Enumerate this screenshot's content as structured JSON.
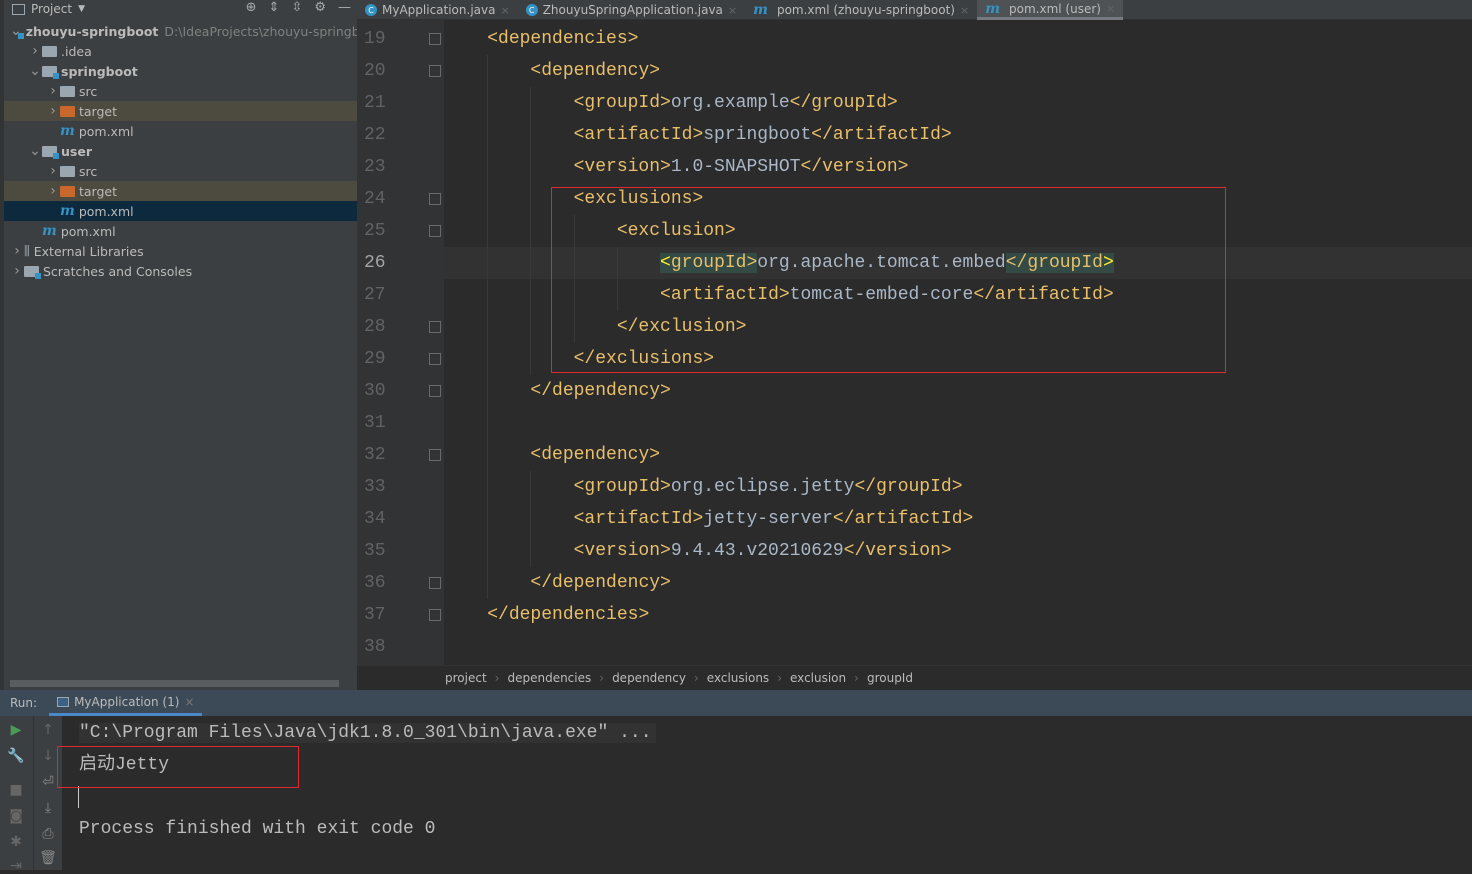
{
  "project_panel": {
    "title": "Project",
    "tree": [
      {
        "label": "zhouyu-springboot",
        "path": "D:\\IdeaProjects\\zhouyu-springb",
        "level": 0,
        "expanded": true,
        "type": "module",
        "bold": true
      },
      {
        "label": ".idea",
        "level": 1,
        "expanded": false,
        "type": "folder"
      },
      {
        "label": "springboot",
        "level": 1,
        "expanded": true,
        "type": "module",
        "bold": true
      },
      {
        "label": "src",
        "level": 2,
        "expanded": false,
        "type": "folder"
      },
      {
        "label": "target",
        "level": 2,
        "expanded": false,
        "type": "target"
      },
      {
        "label": "pom.xml",
        "level": 2,
        "type": "maven"
      },
      {
        "label": "user",
        "level": 1,
        "expanded": true,
        "type": "module",
        "bold": true
      },
      {
        "label": "src",
        "level": 2,
        "expanded": false,
        "type": "folder"
      },
      {
        "label": "target",
        "level": 2,
        "expanded": false,
        "type": "target"
      },
      {
        "label": "pom.xml",
        "level": 2,
        "type": "maven",
        "selected": true
      },
      {
        "label": "pom.xml",
        "level": 1,
        "type": "maven"
      },
      {
        "label": "External Libraries",
        "level": 0,
        "expanded": false,
        "type": "libs"
      },
      {
        "label": "Scratches and Consoles",
        "level": 0,
        "expanded": false,
        "type": "scratch"
      }
    ]
  },
  "tabs": [
    {
      "label": "MyApplication.java",
      "icon": "class"
    },
    {
      "label": "ZhouyuSpringApplication.java",
      "icon": "class"
    },
    {
      "label": "pom.xml (zhouyu-springboot)",
      "icon": "maven"
    },
    {
      "label": "pom.xml (user)",
      "icon": "maven",
      "active": true
    }
  ],
  "editor": {
    "current_line": 26,
    "lines": [
      {
        "n": 19,
        "code": "    <dependencies>",
        "fold": "open"
      },
      {
        "n": 20,
        "code": "        <dependency>",
        "fold": "open"
      },
      {
        "n": 21,
        "code": "            <groupId>org.example</groupId>"
      },
      {
        "n": 22,
        "code": "            <artifactId>springboot</artifactId>"
      },
      {
        "n": 23,
        "code": "            <version>1.0-SNAPSHOT</version>"
      },
      {
        "n": 24,
        "code": "            <exclusions>",
        "fold": "open"
      },
      {
        "n": 25,
        "code": "                <exclusion>",
        "fold": "open"
      },
      {
        "n": 26,
        "code": "                    <groupId>org.apache.tomcat.embed</groupId>"
      },
      {
        "n": 27,
        "code": "                    <artifactId>tomcat-embed-core</artifactId>"
      },
      {
        "n": 28,
        "code": "                </exclusion>",
        "fold": "close"
      },
      {
        "n": 29,
        "code": "            </exclusions>",
        "fold": "close"
      },
      {
        "n": 30,
        "code": "        </dependency>",
        "fold": "close"
      },
      {
        "n": 31,
        "code": ""
      },
      {
        "n": 32,
        "code": "        <dependency>",
        "fold": "open"
      },
      {
        "n": 33,
        "code": "            <groupId>org.eclipse.jetty</groupId>"
      },
      {
        "n": 34,
        "code": "            <artifactId>jetty-server</artifactId>"
      },
      {
        "n": 35,
        "code": "            <version>9.4.43.v20210629</version>"
      },
      {
        "n": 36,
        "code": "        </dependency>",
        "fold": "close"
      },
      {
        "n": 37,
        "code": "    </dependencies>",
        "fold": "close"
      },
      {
        "n": 38,
        "code": ""
      }
    ]
  },
  "breadcrumb": [
    "project",
    "dependencies",
    "dependency",
    "exclusions",
    "exclusion",
    "groupId"
  ],
  "run": {
    "label": "Run:",
    "tab": "MyApplication (1)",
    "console": {
      "command": "\"C:\\Program Files\\Java\\jdk1.8.0_301\\bin\\java.exe\" ...",
      "output": "启动Jetty",
      "finish": "Process finished with exit code 0"
    }
  },
  "colors": {
    "tag": "#e8bf6a",
    "text": "#a9b7c6",
    "highlight_box": "#e0282e",
    "selection": "#0d293e"
  }
}
